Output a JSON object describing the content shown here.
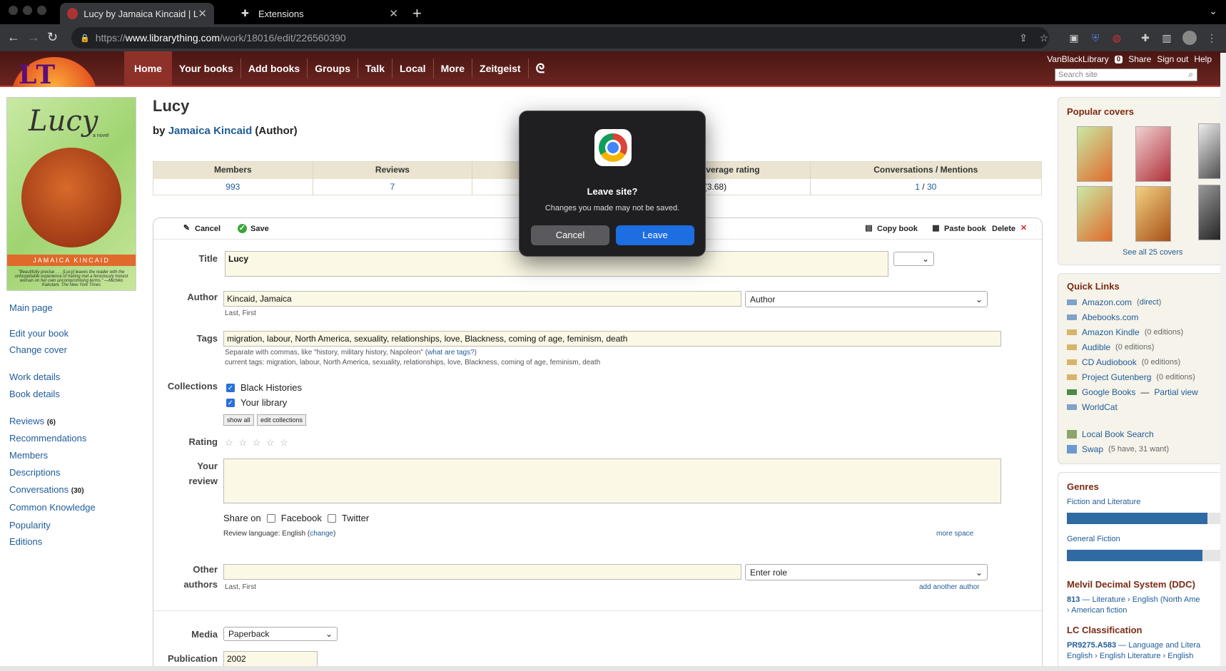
{
  "browser": {
    "tabs": [
      {
        "title": "Lucy by Jamaica Kincaid | Libra",
        "active": true
      },
      {
        "title": "Extensions",
        "active": false
      }
    ],
    "url_prefix": "https://",
    "url_host": "www.librarything.com",
    "url_path": "/work/18016/edit/226560390"
  },
  "site": {
    "logo_text": "LT",
    "nav": [
      "Home",
      "Your books",
      "Add books",
      "Groups",
      "Talk",
      "Local",
      "More",
      "Zeitgeist"
    ],
    "user": "VanBlackLibrary",
    "message_count": "0",
    "links": [
      "Share",
      "Sign out",
      "Help"
    ],
    "search_placeholder": "Search site"
  },
  "cover": {
    "title": "Lucy",
    "subtitle": "a novel",
    "author_band": "JAMAICA KINCAID",
    "blurb": "\"Beautifully precise . . . [Lucy] leaves the reader with the unforgettable experience of having met a ferociously honest woman on her own uncompromising terms.\" —Michiko Kakutani, The New York Times"
  },
  "leftnav": {
    "main_page": "Main page",
    "edit_your_book": "Edit your book",
    "change_cover": "Change cover",
    "work_details": "Work details",
    "book_details": "Book details",
    "reviews": "Reviews",
    "reviews_count": "(6)",
    "recommendations": "Recommendations",
    "members": "Members",
    "descriptions": "Descriptions",
    "conversations": "Conversations",
    "conversations_count": "(30)",
    "common_knowledge": "Common Knowledge",
    "popularity": "Popularity",
    "editions": "Editions"
  },
  "book": {
    "title": "Lucy",
    "by": "by",
    "author": "Jamaica Kincaid",
    "role": "(Author)"
  },
  "stats": {
    "headers": [
      "Members",
      "Reviews",
      "",
      "verage rating",
      "Conversations / Mentions"
    ],
    "members": "993",
    "reviews": "7",
    "rating": "½ (3.68)",
    "conversations": "1",
    "mentions": "30"
  },
  "toolbar": {
    "cancel": "Cancel",
    "save": "Save",
    "copy_book": "Copy book",
    "paste_book": "Paste book",
    "delete": "Delete"
  },
  "form": {
    "title_label": "Title",
    "title_value": "Lucy",
    "author_label": "Author",
    "author_value": "Kincaid, Jamaica",
    "author_role": "Author",
    "last_first": "Last, First",
    "tags_label": "Tags",
    "tags_value": "migration, labour, North America, sexuality, relationships, love, Blackness, coming of age, feminism, death",
    "tags_hint": "Separate with commas, like \"history, military history, Napoleon\" (",
    "tags_hint_link": "what are tags?",
    "tags_hint_end": ")",
    "current_tags": "current tags: migration, labour, North America, sexuality, relationships, love, Blackness, coming of age, feminism, death",
    "collections_label": "Collections",
    "collections": [
      "Black Histories",
      "Your library"
    ],
    "show_all": "show all",
    "edit_collections": "edit collections",
    "rating_label": "Rating",
    "rating_stars": "☆ ☆ ☆ ☆ ☆",
    "review_label_1": "Your",
    "review_label_2": "review",
    "share_on": "Share on",
    "facebook": "Facebook",
    "twitter": "Twitter",
    "review_language": "Review language: English (",
    "change": "change",
    "review_language_end": ")",
    "more_space": "more space",
    "other_label_1": "Other",
    "other_label_2": "authors",
    "enter_role": "Enter role",
    "add_another_author": "add another author",
    "media_label": "Media",
    "media_value": "Paperback",
    "publication_label": "Publication",
    "publication_value": "2002"
  },
  "right": {
    "popular_covers": "Popular covers",
    "see_all_covers": "See all 25 covers",
    "quick_links": "Quick Links",
    "links": [
      {
        "name": "Amazon.com",
        "extra": "(",
        "extra_link": "direct",
        "extra_end": ")"
      },
      {
        "name": "Abebooks.com"
      },
      {
        "name": "Amazon Kindle",
        "editions": "(0 editions)"
      },
      {
        "name": "Audible",
        "editions": "(0 editions)"
      },
      {
        "name": "CD Audiobook",
        "editions": "(0 editions)"
      },
      {
        "name": "Project Gutenberg",
        "editions": "(0 editions)"
      },
      {
        "name": "Google Books",
        "dash": "—",
        "partial": "Partial view"
      },
      {
        "name": "WorldCat"
      }
    ],
    "local_book_search": "Local Book Search",
    "swap": "Swap",
    "swap_detail": "(5 have, 31 want)",
    "genres": "Genres",
    "genre_1": "Fiction and Literature",
    "genre_1_share": 0.88,
    "genre_2": "General Fiction",
    "genre_2_share": 0.85,
    "ddc_heading": "Melvil Decimal System (DDC)",
    "ddc_number": "813",
    "ddc_path": "— Literature › English (North Ame",
    "ddc_path_2": "› American fiction",
    "lcc_heading": "LC Classification",
    "lcc_number": "PR9275.A583",
    "lcc_path": "— Language and Litera",
    "lcc_path_2": "English › English Literature › English"
  },
  "dialog": {
    "title": "Leave site?",
    "message": "Changes you made may not be saved.",
    "cancel": "Cancel",
    "leave": "Leave"
  }
}
